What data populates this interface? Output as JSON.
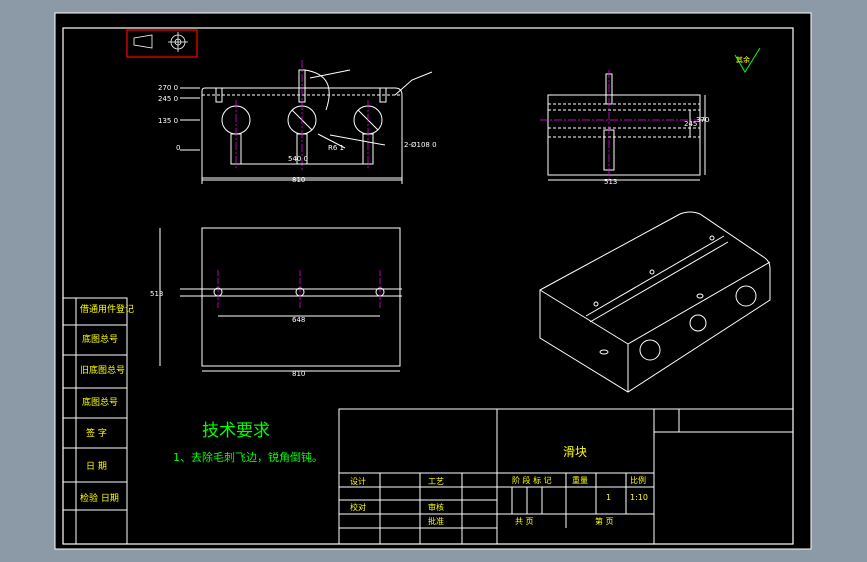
{
  "colors": {
    "background": "#8c99a7",
    "canvas": "#000000",
    "line": "#ffffff",
    "text_green": "#00ff00",
    "text_yellow": "#ffff00",
    "text_magenta": "#ff00ff",
    "marker_red": "#ff0000"
  },
  "toolbar": {
    "icons": [
      "taper-view-icon",
      "crosshair-view-icon"
    ]
  },
  "top_view": {
    "dims": {
      "d270": "270 0",
      "d245": "245 0",
      "d135": "135 0",
      "d0": "0",
      "r_label": "R6 1",
      "d540": "540 0",
      "d810": "810",
      "holes": "2-Ø108 0"
    }
  },
  "side_view": {
    "dims": {
      "d513": "513",
      "d245": "245",
      "d370": "370"
    }
  },
  "plan_view": {
    "dims": {
      "d513": "513",
      "d648": "648",
      "d810": "810"
    }
  },
  "roughness": "其余",
  "tech_req": {
    "title": "技术要求",
    "item1": "1、去除毛刺飞边，锐角倒钝。"
  },
  "left_stamps": [
    "借通用件登记",
    "底图总号",
    "旧底图总号",
    "底图总号",
    "签 字",
    "日 期",
    "检验 日期"
  ],
  "title_block": {
    "part_name": "滑块",
    "design": "设计",
    "check": "校对",
    "audit": "审核",
    "approve": "批准",
    "process": "工艺",
    "stage_mark": "阶 段 标 记",
    "weight": "重量",
    "ratio": "比例",
    "scale_ratio": "1:10",
    "sheet_count": "1",
    "sheet_total": "共  页",
    "sheet_no": "第  页"
  }
}
